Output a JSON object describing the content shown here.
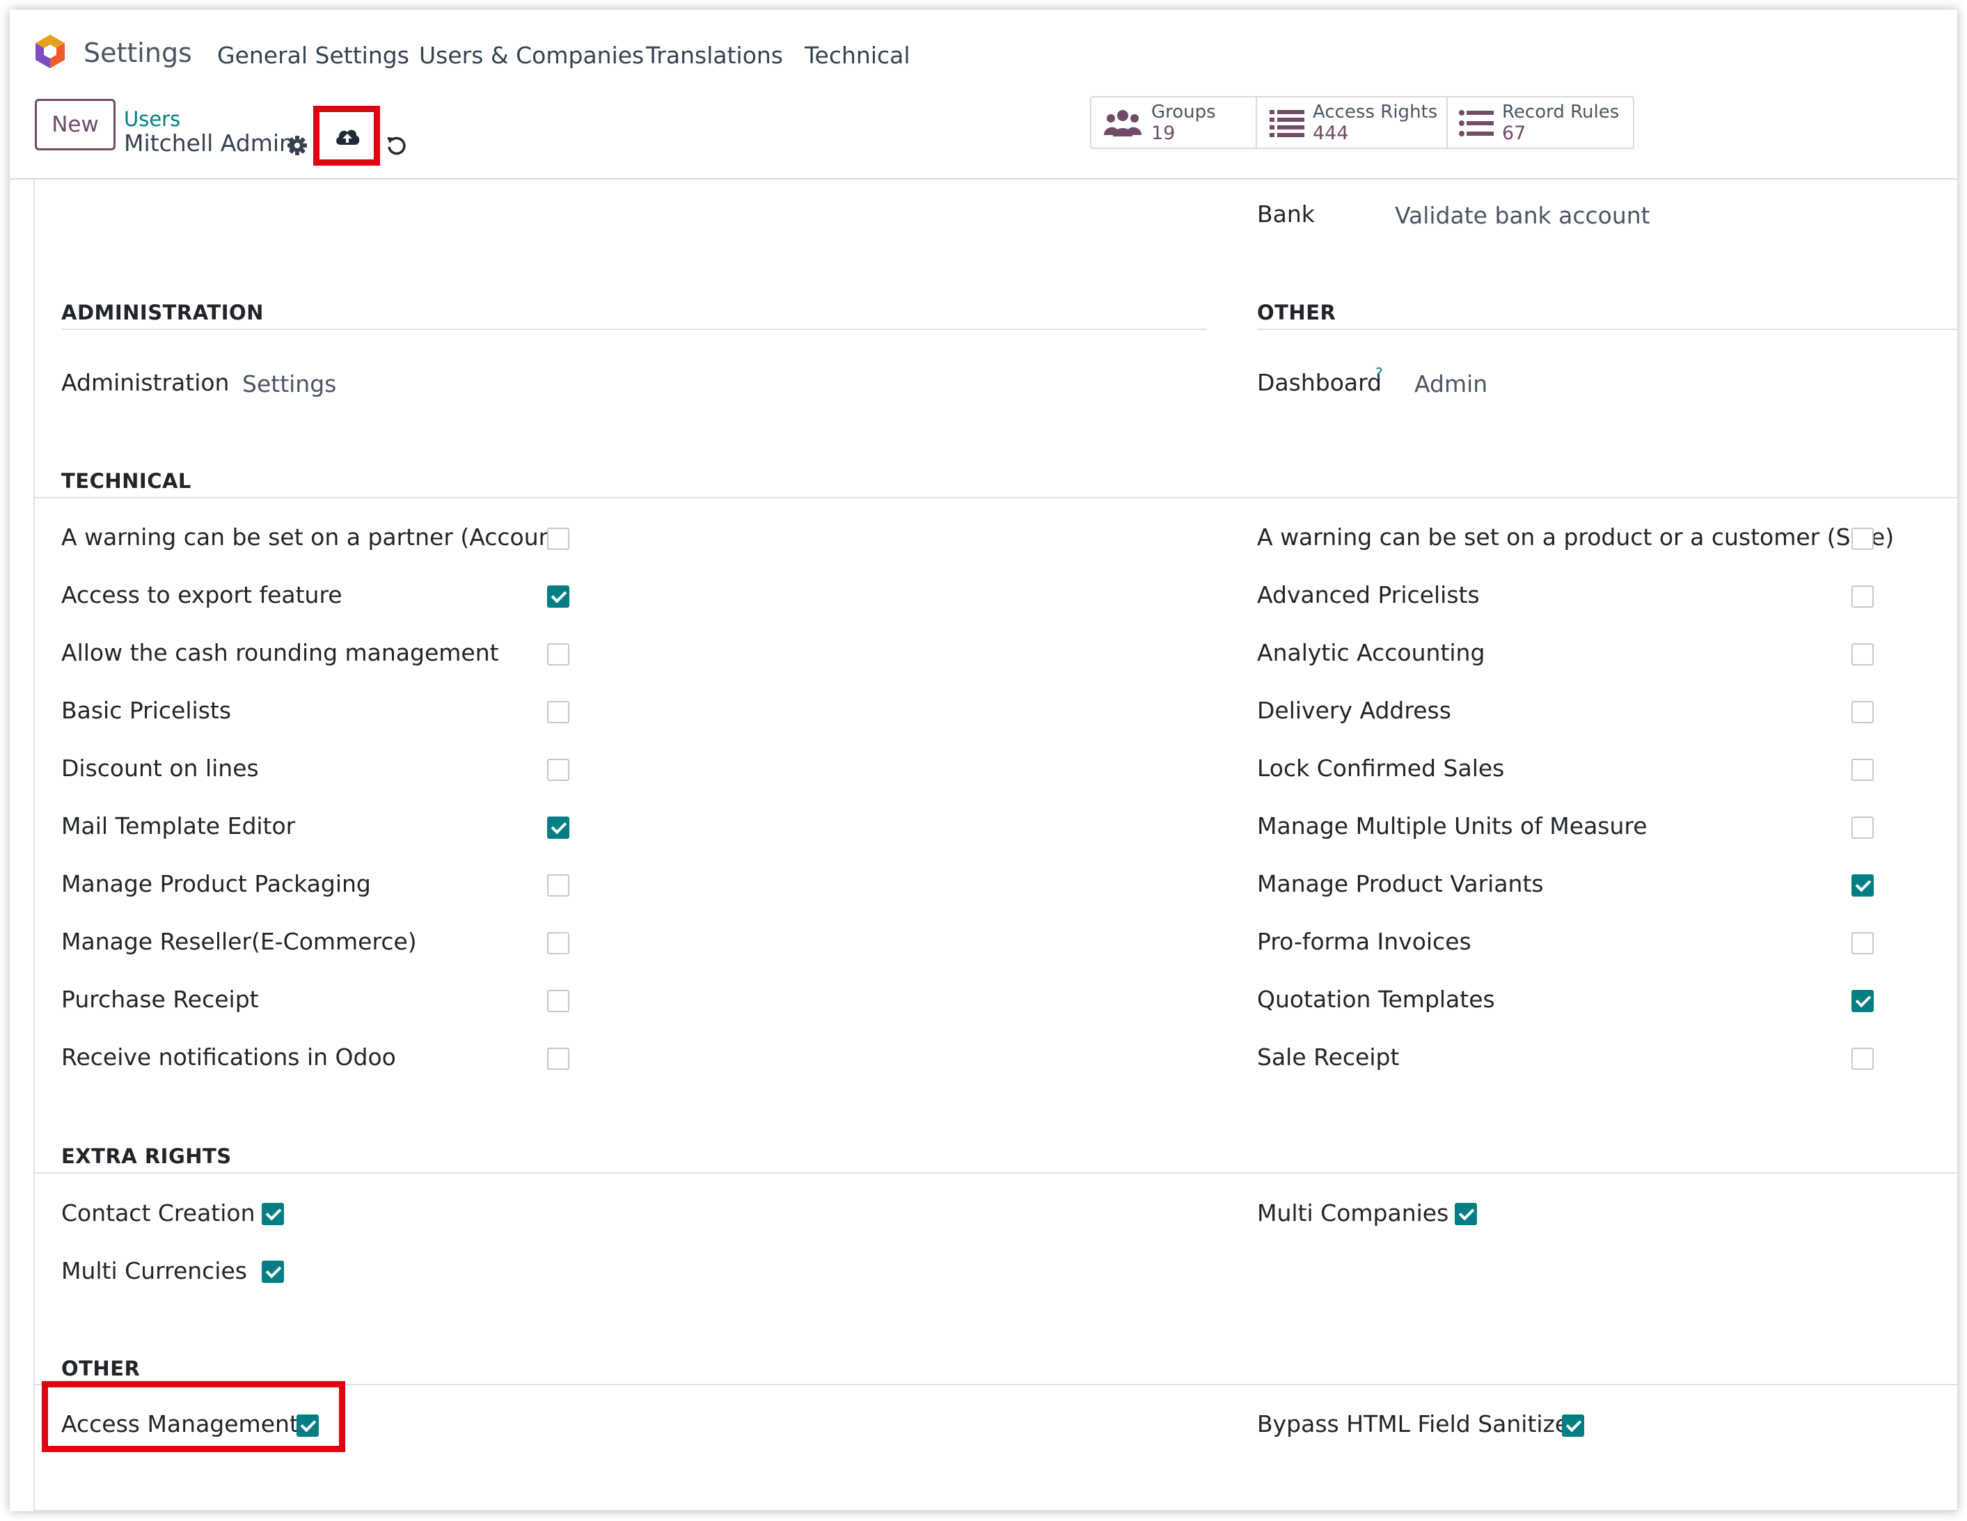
{
  "nav": {
    "app_title": "Settings",
    "menu": [
      "General Settings",
      "Users & Companies",
      "Translations",
      "Technical"
    ]
  },
  "control_panel": {
    "new_button": "New",
    "breadcrumb_parent": "Users",
    "breadcrumb_current": "Mitchell Admin",
    "icons": [
      "gear-icon",
      "cloud-upload-icon",
      "undo-icon"
    ],
    "stat_buttons": [
      {
        "label": "Groups",
        "value": "19",
        "icon": "users-icon"
      },
      {
        "label": "Access Rights",
        "value": "444",
        "icon": "list-icon"
      },
      {
        "label": "Record Rules",
        "value": "67",
        "icon": "list-icon"
      }
    ]
  },
  "bank": {
    "label": "Bank",
    "value": "Validate bank account"
  },
  "administration": {
    "title": "ADMINISTRATION",
    "field_label": "Administration",
    "field_value": "Settings"
  },
  "other_top": {
    "title": "OTHER",
    "field_label": "Dashboard",
    "help_mark": "?",
    "field_value": "Admin"
  },
  "technical": {
    "title": "TECHNICAL",
    "left": [
      {
        "label": "A warning can be set on a partner (Account)",
        "checked": false
      },
      {
        "label": "Access to export feature",
        "checked": true
      },
      {
        "label": "Allow the cash rounding management",
        "checked": false
      },
      {
        "label": "Basic Pricelists",
        "checked": false
      },
      {
        "label": "Discount on lines",
        "checked": false
      },
      {
        "label": "Mail Template Editor",
        "checked": true
      },
      {
        "label": "Manage Product Packaging",
        "checked": false
      },
      {
        "label": "Manage Reseller(E-Commerce)",
        "checked": false
      },
      {
        "label": "Purchase Receipt",
        "checked": false
      },
      {
        "label": "Receive notifications in Odoo",
        "checked": false
      }
    ],
    "right": [
      {
        "label": "A warning can be set on a product or a customer (Sale)",
        "checked": false
      },
      {
        "label": "Advanced Pricelists",
        "checked": false
      },
      {
        "label": "Analytic Accounting",
        "checked": false
      },
      {
        "label": "Delivery Address",
        "checked": false
      },
      {
        "label": "Lock Confirmed Sales",
        "checked": false
      },
      {
        "label": "Manage Multiple Units of Measure",
        "checked": false
      },
      {
        "label": "Manage Product Variants",
        "checked": true
      },
      {
        "label": "Pro-forma Invoices",
        "checked": false
      },
      {
        "label": "Quotation Templates",
        "checked": true
      },
      {
        "label": "Sale Receipt",
        "checked": false
      }
    ]
  },
  "extra_rights": {
    "title": "EXTRA RIGHTS",
    "left": [
      {
        "label": "Contact Creation",
        "checked": true
      },
      {
        "label": "Multi Currencies",
        "checked": true
      }
    ],
    "right": [
      {
        "label": "Multi Companies",
        "checked": true
      }
    ]
  },
  "other_bottom": {
    "title": "OTHER",
    "left": [
      {
        "label": "Access Management",
        "checked": true
      }
    ],
    "right": [
      {
        "label": "Bypass HTML Field Sanitize",
        "checked": true
      }
    ]
  },
  "colors": {
    "brand": "#714b67",
    "accent": "#017e84",
    "highlight": "#e0000f"
  }
}
